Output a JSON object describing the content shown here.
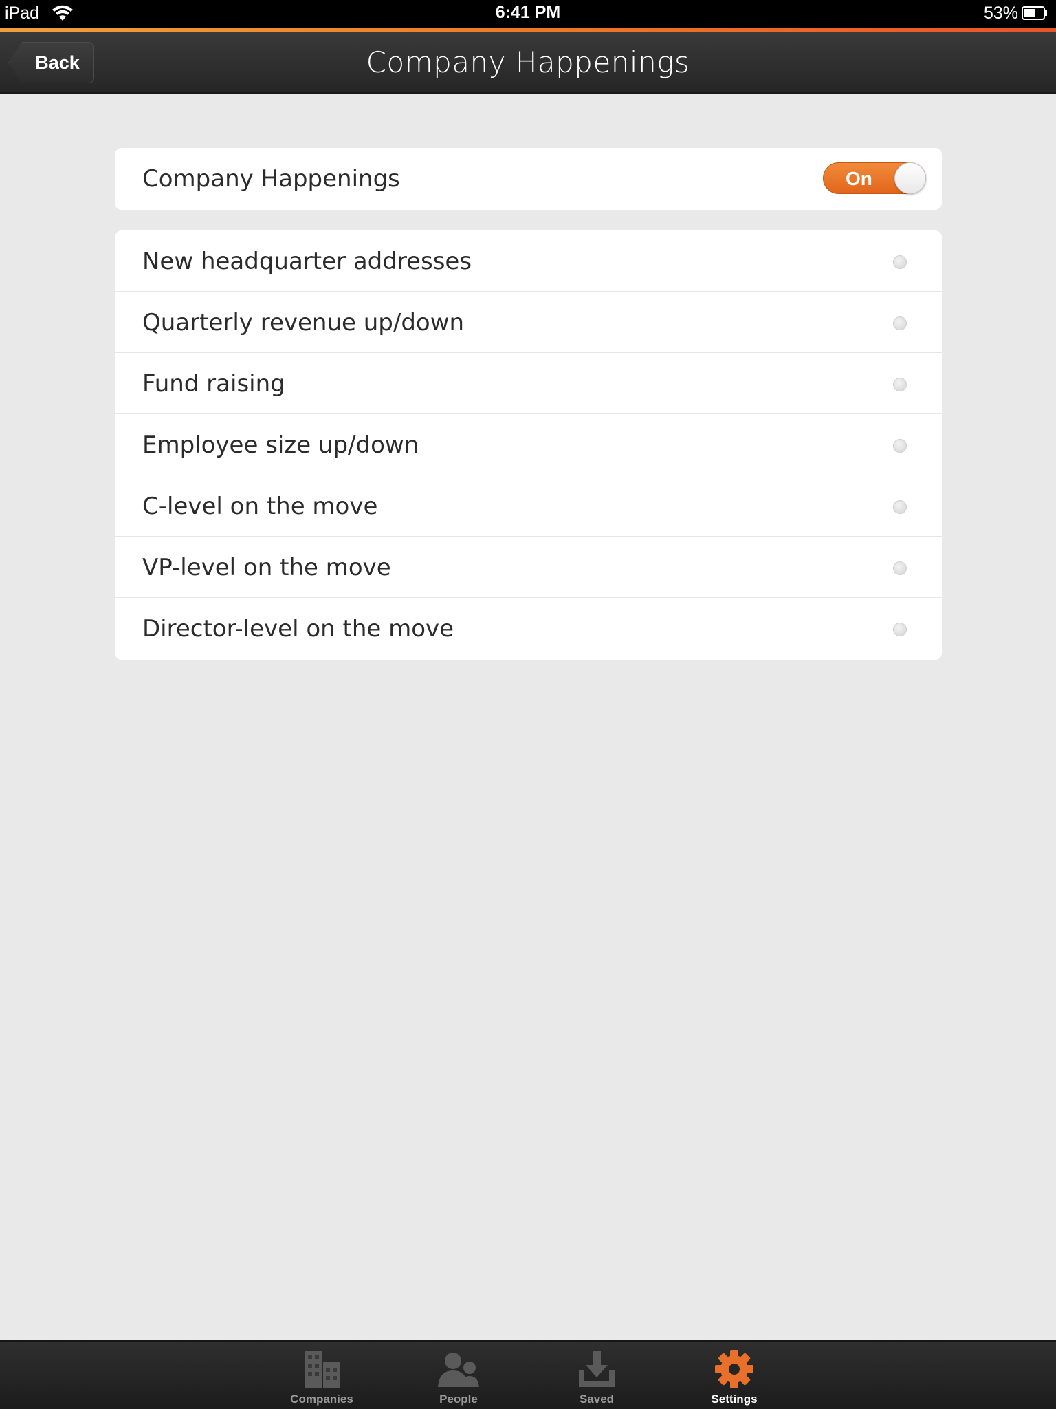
{
  "status_bar": {
    "device": "iPad",
    "time": "6:41 PM",
    "battery": "53%"
  },
  "nav": {
    "back_label": "Back",
    "title": "Company Happenings"
  },
  "master_setting": {
    "label": "Company Happenings",
    "toggle_label": "On",
    "toggle_state": "on"
  },
  "options": [
    {
      "label": "New headquarter addresses",
      "selected": false
    },
    {
      "label": "Quarterly revenue up/down",
      "selected": false
    },
    {
      "label": "Fund raising",
      "selected": false
    },
    {
      "label": "Employee size up/down",
      "selected": false
    },
    {
      "label": "C-level on the move",
      "selected": false
    },
    {
      "label": "VP-level on the move",
      "selected": false
    },
    {
      "label": "Director-level on the move",
      "selected": false
    }
  ],
  "tabs": [
    {
      "label": "Companies",
      "icon": "buildings-icon"
    },
    {
      "label": "People",
      "icon": "people-icon"
    },
    {
      "label": "Saved",
      "icon": "download-tray-icon"
    },
    {
      "label": "Settings",
      "icon": "gear-icon",
      "active": true
    }
  ],
  "colors": {
    "accent": "#e8702a",
    "background": "#e9e9e9",
    "navbar": "#2f2f2f"
  }
}
